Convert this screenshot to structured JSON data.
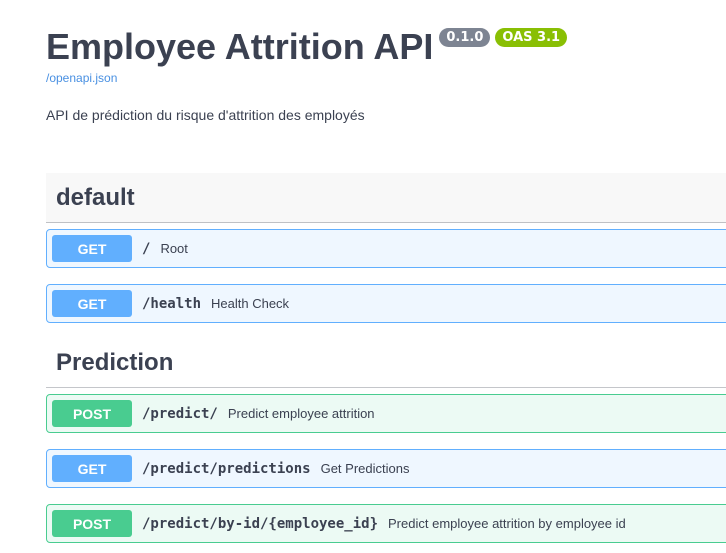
{
  "info": {
    "title": "Employee Attrition API",
    "version_badge": "0.1.0",
    "oas_badge": "OAS 3.1",
    "spec_link": "/openapi.json",
    "description": "API de prédiction du risque d'attrition des employés"
  },
  "sections": {
    "default": {
      "title": "default",
      "ops": [
        {
          "method": "GET",
          "path": "/",
          "summary": "Root"
        },
        {
          "method": "GET",
          "path": "/health",
          "summary": "Health Check"
        }
      ]
    },
    "prediction": {
      "title": "Prediction",
      "ops": [
        {
          "method": "POST",
          "path": "/predict/",
          "summary": "Predict employee attrition"
        },
        {
          "method": "GET",
          "path": "/predict/predictions",
          "summary": "Get Predictions"
        },
        {
          "method": "POST",
          "path": "/predict/by-id/{employee_id}",
          "summary": "Predict employee attrition by employee id"
        }
      ]
    }
  },
  "colors": {
    "get": "#61affe",
    "post": "#49cc90",
    "version_badge": "#7d8492",
    "oas_badge": "#89bf04",
    "link": "#4990e2"
  }
}
